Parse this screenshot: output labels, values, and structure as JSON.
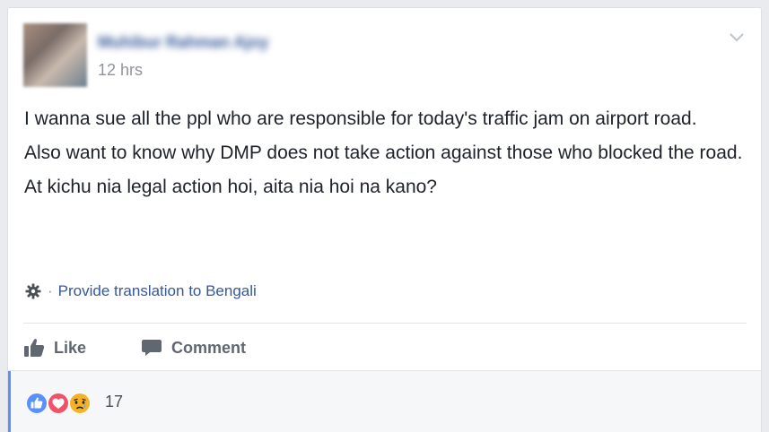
{
  "post": {
    "author": "Muhibur Rahman Ajoy",
    "timestamp": "12 hrs",
    "paragraphs": [
      "I wanna sue all the ppl who are responsible for today's traffic jam on airport road.",
      "Also want to know why DMP does not take action against those who blocked the road.",
      "At kichu nia legal action hoi, aita nia hoi na kano?"
    ],
    "translation_separator": "·",
    "translation_link": "Provide translation to Bengali"
  },
  "actions": {
    "like_label": "Like",
    "comment_label": "Comment"
  },
  "reactions": {
    "icons": [
      "like-icon",
      "love-icon",
      "sad-icon"
    ],
    "count": "17"
  },
  "colors": {
    "like_blue": "#5890ff",
    "love_red": "#f25268",
    "sad_yellow": "#f7b125",
    "link_blue": "#365899",
    "text_dark": "#1d2129"
  }
}
